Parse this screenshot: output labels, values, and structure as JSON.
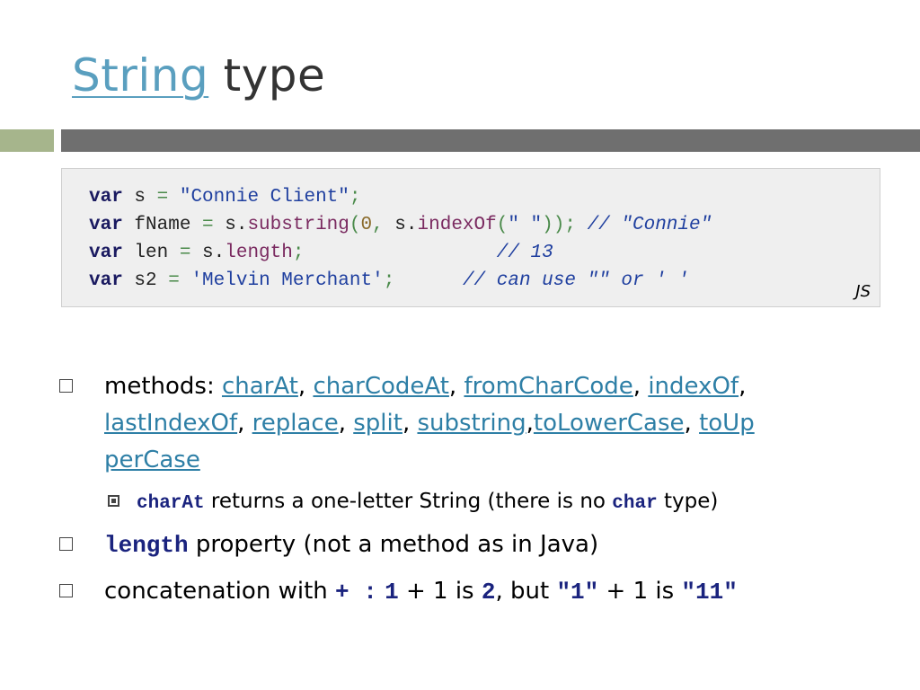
{
  "slide": {
    "title_link": "String",
    "title_rest": " type"
  },
  "code": {
    "tag": "JS",
    "lines": [
      {
        "parts": [
          [
            "kw",
            "var"
          ],
          [
            "t",
            " s "
          ],
          [
            "op",
            "="
          ],
          [
            "t",
            " "
          ],
          [
            "str",
            "\"Connie Client\""
          ],
          [
            "op",
            ";"
          ]
        ]
      },
      {
        "parts": [
          [
            "kw",
            "var"
          ],
          [
            "t",
            " fName "
          ],
          [
            "op",
            "="
          ],
          [
            "t",
            " s."
          ],
          [
            "prop",
            "substring"
          ],
          [
            "op",
            "("
          ],
          [
            "num",
            "0"
          ],
          [
            "op",
            ","
          ],
          [
            "t",
            " s."
          ],
          [
            "prop",
            "indexOf"
          ],
          [
            "op",
            "("
          ],
          [
            "str",
            "\" \""
          ],
          [
            "op",
            "));"
          ],
          [
            "t",
            " "
          ],
          [
            "cmt",
            "// \"Connie\""
          ]
        ]
      },
      {
        "parts": [
          [
            "kw",
            "var"
          ],
          [
            "t",
            " len "
          ],
          [
            "op",
            "="
          ],
          [
            "t",
            " s."
          ],
          [
            "prop",
            "length"
          ],
          [
            "op",
            ";"
          ],
          [
            "t",
            "                 "
          ],
          [
            "cmt",
            "// 13"
          ]
        ]
      },
      {
        "parts": [
          [
            "kw",
            "var"
          ],
          [
            "t",
            " s2 "
          ],
          [
            "op",
            "="
          ],
          [
            "t",
            " "
          ],
          [
            "str",
            "'Melvin Merchant'"
          ],
          [
            "op",
            ";"
          ],
          [
            "t",
            "      "
          ],
          [
            "cmt",
            "// can use \"\" or ' '"
          ]
        ]
      }
    ]
  },
  "bullets": {
    "methods": {
      "prefix": "methods: ",
      "items": [
        "charAt",
        "charCodeAt",
        "fromCharCode",
        "indexOf",
        "lastIndexOf",
        "replace",
        "split",
        "substring",
        "toLowerCase",
        "toUpperCase"
      ],
      "line1": [
        [
          "text",
          "methods: "
        ],
        [
          "link",
          "charAt"
        ],
        [
          "text",
          ", "
        ],
        [
          "link",
          "charCodeAt"
        ],
        [
          "text",
          ", "
        ],
        [
          "link",
          "fromCharCode"
        ],
        [
          "text",
          ", "
        ],
        [
          "link",
          "indexOf"
        ],
        [
          "text",
          ","
        ]
      ],
      "line2": [
        [
          "link",
          "lastIndexOf"
        ],
        [
          "text",
          ", "
        ],
        [
          "link",
          "replace"
        ],
        [
          "text",
          ", "
        ],
        [
          "link",
          "split"
        ],
        [
          "text",
          ", "
        ],
        [
          "link",
          "substring"
        ],
        [
          "text",
          ","
        ],
        [
          "link",
          "toLowerCase"
        ],
        [
          "text",
          ", "
        ],
        [
          "link",
          "toUp"
        ]
      ],
      "line3": [
        [
          "link",
          "perCase"
        ]
      ]
    },
    "sub": {
      "code1": "charAt",
      "text1": " returns a one-letter String (there is no ",
      "code2": "char",
      "text2": " type)"
    },
    "length": {
      "code": "length",
      "text": " property (not a method as in Java)"
    },
    "concat": {
      "t1": "concatenation with ",
      "c1": "+ :",
      "t2": " ",
      "c2": "1",
      "t3": " + 1 is ",
      "c3": "2",
      "t4": ", but ",
      "c4": "\"1\"",
      "t5": " + 1 is ",
      "c5": "\"11\""
    }
  }
}
